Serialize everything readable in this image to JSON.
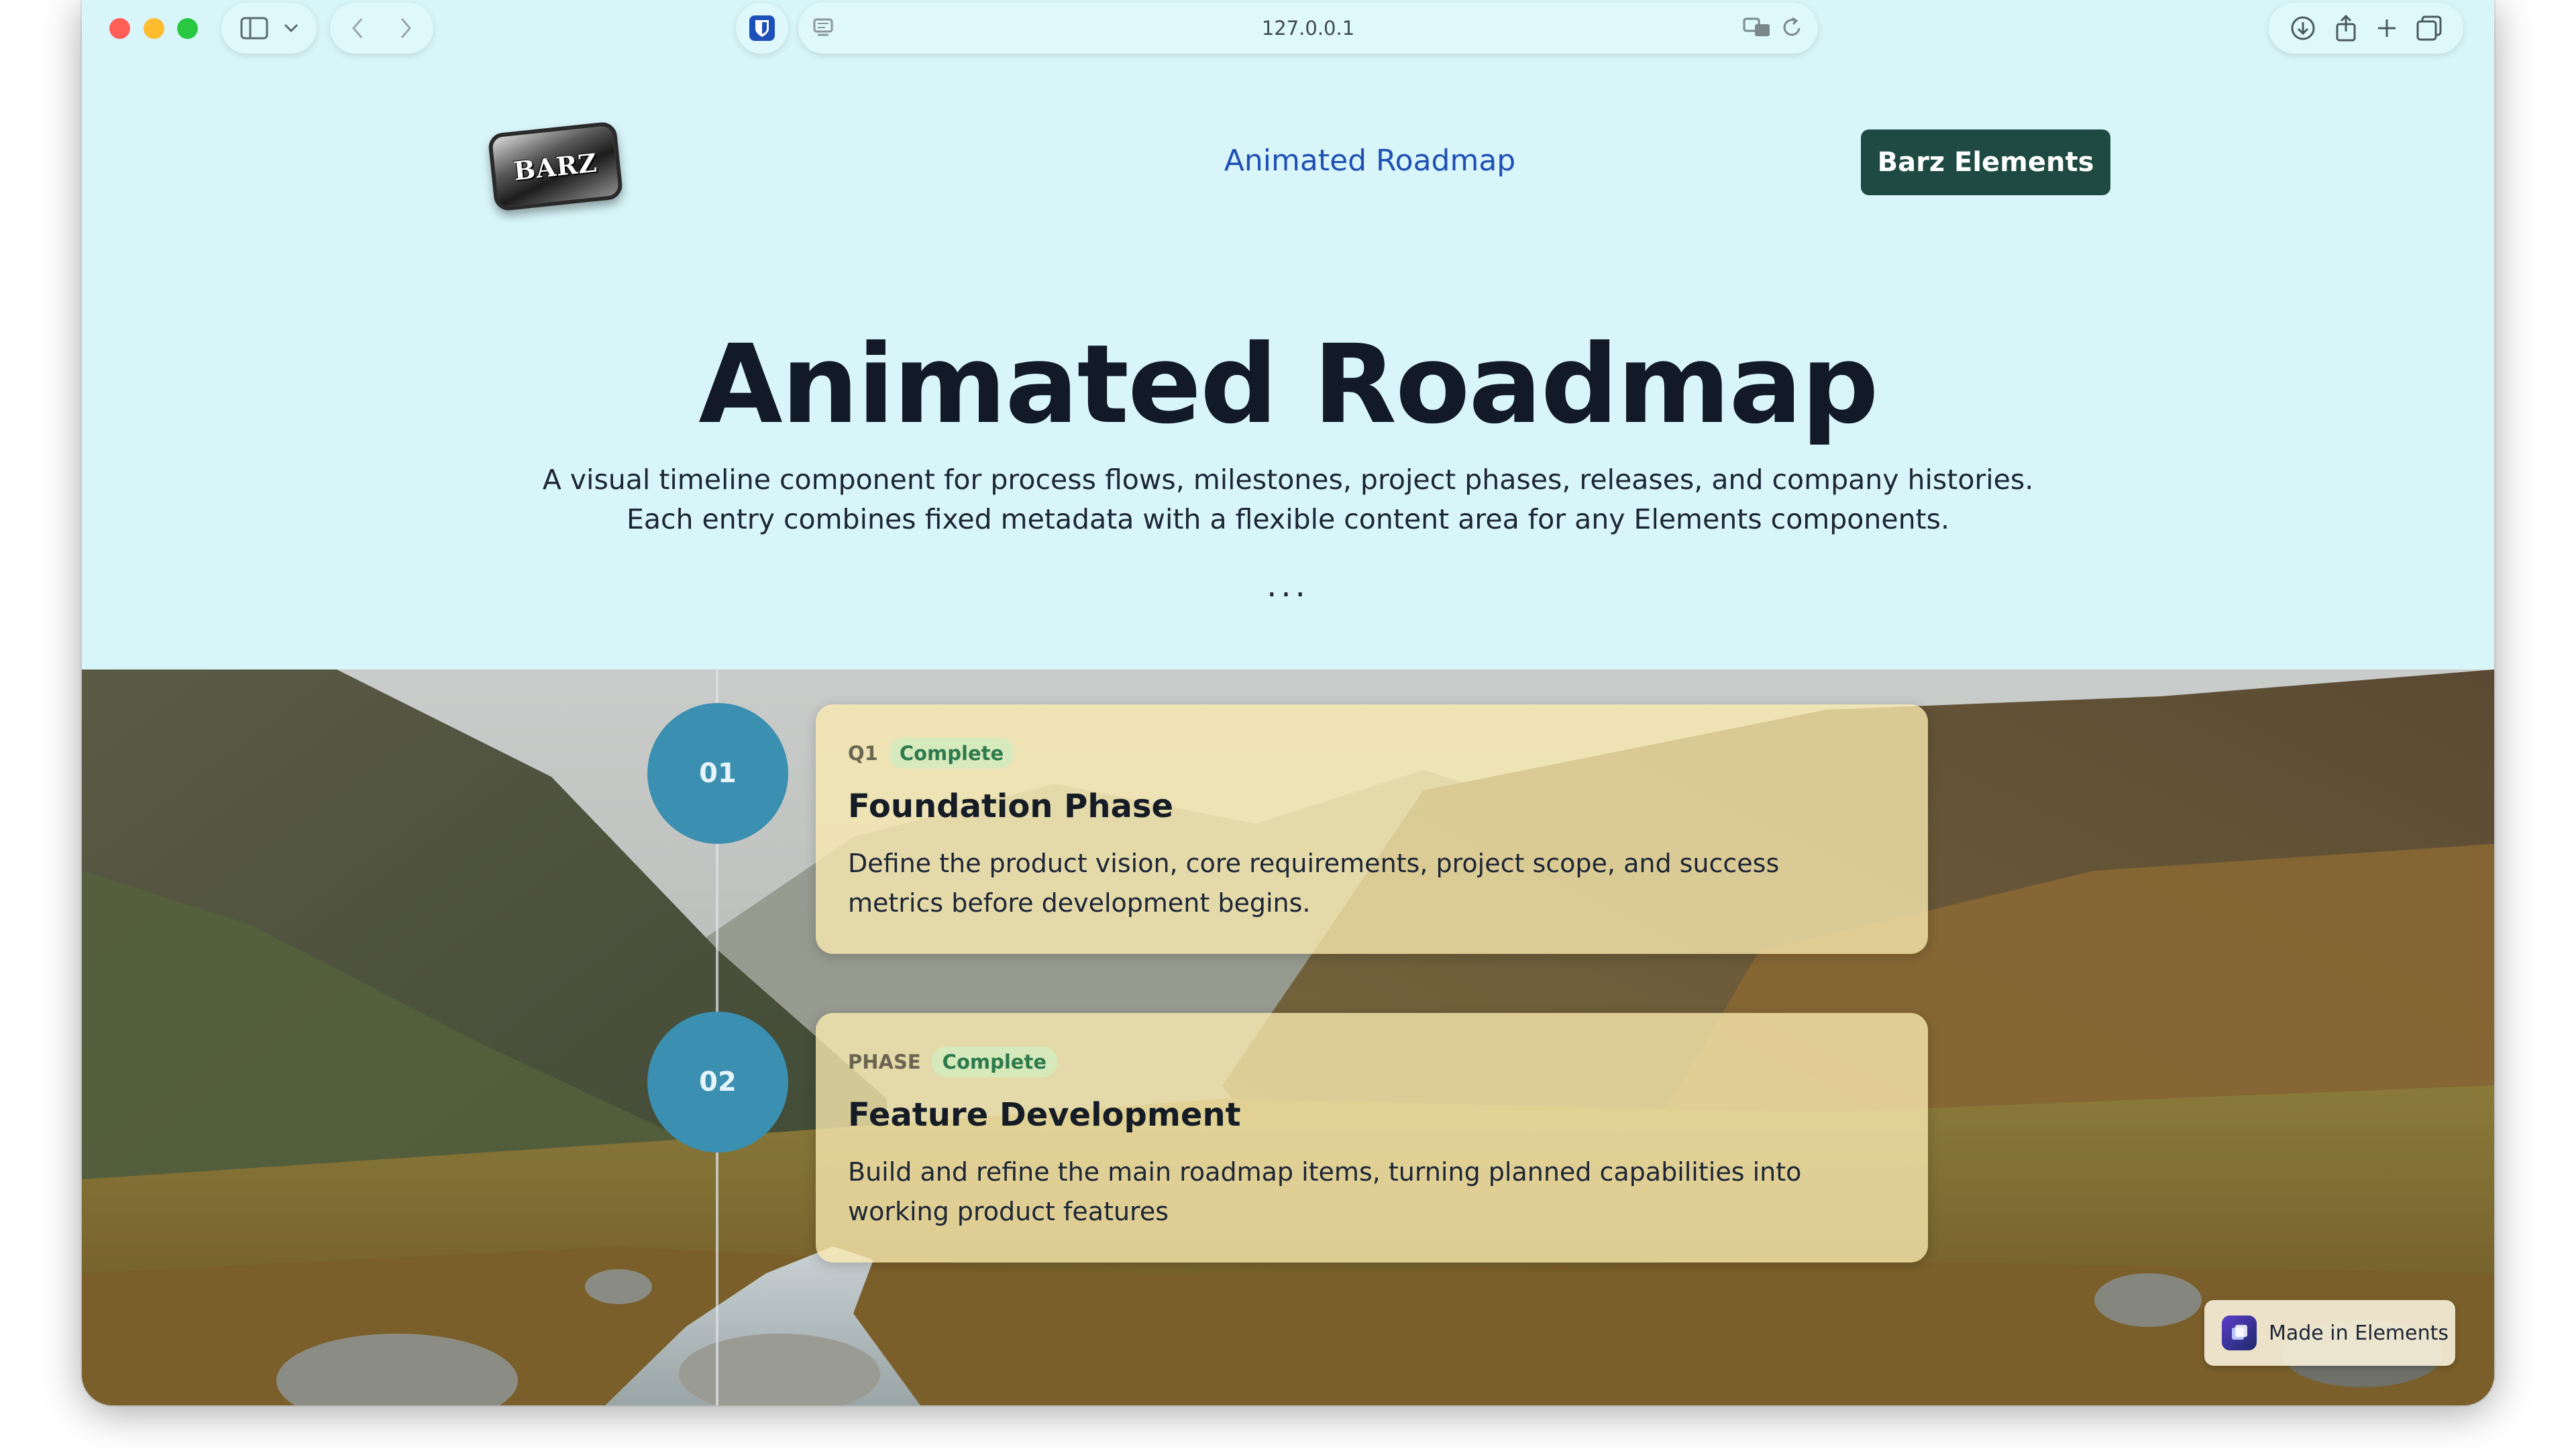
{
  "browser": {
    "url": "127.0.0.1",
    "icons": {
      "sidebar": "sidebar-icon",
      "chevron": "chevron-down-icon",
      "back": "back-arrow-icon",
      "forward": "forward-arrow-icon",
      "extension": "bitwarden-shield-icon",
      "page_menu": "page-menu-icon",
      "translate": "translate-icon",
      "reload": "reload-icon",
      "download": "download-icon",
      "share": "share-icon",
      "new_tab": "plus-icon",
      "tabs": "tab-overview-icon"
    }
  },
  "header": {
    "logo_text": "BARZ",
    "nav_link": "Animated Roadmap",
    "cta_label": "Barz Elements"
  },
  "hero": {
    "title": "Animated Roadmap",
    "description": "A visual timeline component for process flows, milestones, project phases, releases, and company histories. Each entry combines fixed metadata with a flexible content area for any Elements components.",
    "ellipsis": "..."
  },
  "timeline": {
    "items": [
      {
        "number": "01",
        "meta_label": "Q1",
        "status": "Complete",
        "title": "Foundation Phase",
        "body": "Define the product vision, core requirements, project scope, and success metrics before development begins."
      },
      {
        "number": "02",
        "meta_label": "PHASE",
        "status": "Complete",
        "title": "Feature Development",
        "body": "Build and refine the main roadmap items, turning planned capabilities into working product features"
      }
    ]
  },
  "footer_badge": {
    "label": "Made in Elements"
  },
  "colors": {
    "page_background": "#d8f6fa",
    "cta_background": "#1e4a43",
    "link": "#1f4fb3",
    "node": "#3b8fb0",
    "badge_text": "#2e7a4c"
  }
}
